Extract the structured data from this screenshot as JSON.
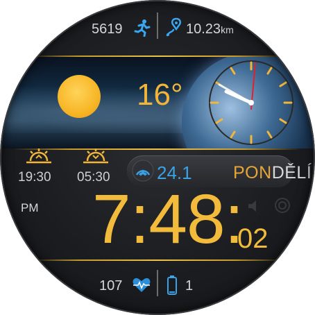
{
  "top": {
    "steps": "5619",
    "distance_value": "10.23",
    "distance_unit": "km"
  },
  "weather": {
    "temperature": "16°",
    "sunrise": "19:30",
    "sunset": "05:30"
  },
  "info": {
    "value": "24.1",
    "day_part1": "PON",
    "day_part2": "DĚLÍ"
  },
  "time": {
    "ampm": "PM",
    "main": "7:48:",
    "seconds": "02"
  },
  "bottom": {
    "heart_rate": "107",
    "battery": "1"
  },
  "icons": {
    "steps": "running-person-icon",
    "distance": "route-pin-icon",
    "sunrise": "sunrise-icon",
    "sunset": "sunset-icon",
    "info": "signal-arc-icon",
    "heart": "heart-pulse-icon",
    "battery": "battery-icon"
  },
  "colors": {
    "accent_gold": "#f3bb3c",
    "accent_blue": "#3aa2e6",
    "text": "#d7d7d7",
    "background": "#1c1d20"
  }
}
